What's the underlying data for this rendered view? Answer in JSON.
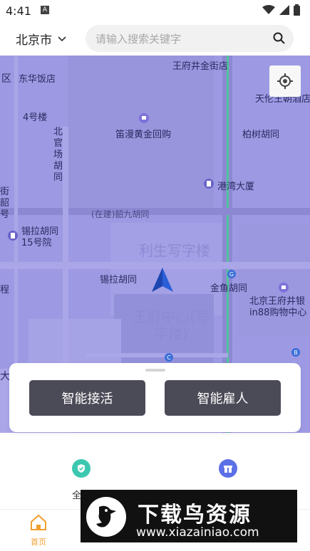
{
  "status_bar": {
    "time": "4:41",
    "notification": "A"
  },
  "header": {
    "city": "北京市",
    "search_placeholder": "请输入搜索关键字"
  },
  "map": {
    "labels": {
      "dongdan": "区",
      "fanzhuang": "东华饭店",
      "bldg4": "4号楼",
      "wangfu_top": "王府井金街店",
      "tiantian": "天伦王朝酒店",
      "dimanhuang": "笛漫黄金回购",
      "baishu": "柏树胡同",
      "beiguan": "北官场胡同",
      "gangwan": "港湾大厦",
      "jieshao": "街韶号",
      "zaijian": "(在建)韶九胡同",
      "xila15": "锡拉胡同15号院",
      "lisheng": "利生写字楼",
      "xila": "锡拉胡同",
      "jinyu": "金鱼胡同",
      "cheng": "程",
      "beijing_wfj": "北京王府井银in88购物中心",
      "wangfu_center": "王府中心(写字楼)",
      "da": "大"
    }
  },
  "card": {
    "left_button": "智能接活",
    "right_button": "智能雇人"
  },
  "features": {
    "left_label": "全民",
    "right_label": ""
  },
  "tabbar": {
    "home": "首页",
    "tab2": "",
    "tab3": "",
    "tab4": ""
  },
  "watermark": {
    "title": "下载鸟资源",
    "url": "www.xiazainiao.com"
  },
  "colors": {
    "map_bg": "#9d9ae3",
    "button": "#4b4a57",
    "accent": "#f0a030",
    "road": "#52c49a"
  }
}
